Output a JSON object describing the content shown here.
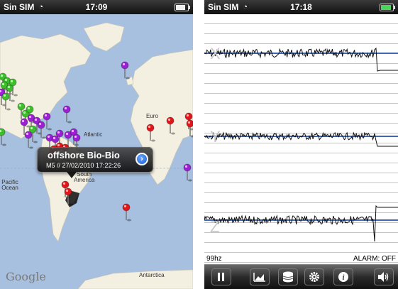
{
  "map_screen": {
    "status": {
      "carrier": "Sin SIM",
      "time": "17:09"
    },
    "labels": {
      "europe": "Euro",
      "atlantic": "Atlantic",
      "pacific_ocean": "Pacific\nOcean",
      "south_america": "South\nAmerica",
      "antarctica": "Antarctica"
    },
    "callout": {
      "title": "offshore Bio-Bio",
      "subtitle": "M5 // 27/02/2010 17:22:26"
    },
    "google": "Google",
    "colors": {
      "red": "#e0161b",
      "green": "#3cbf2a",
      "purple": "#9b1fd3"
    }
  },
  "seismo_screen": {
    "status": {
      "carrier": "Sin SIM",
      "time": "17:18"
    },
    "axes": [
      "X",
      "Y",
      "Z"
    ],
    "sample_rate": "99hz",
    "alarm": "ALARM: OFF",
    "toolbar": [
      {
        "icon": "pause-icon"
      },
      {
        "icon": "graph-icon"
      },
      {
        "icon": "database-icon"
      },
      {
        "icon": "gear-icon"
      },
      {
        "icon": "info-icon"
      },
      {
        "icon": "speaker-icon"
      }
    ]
  }
}
